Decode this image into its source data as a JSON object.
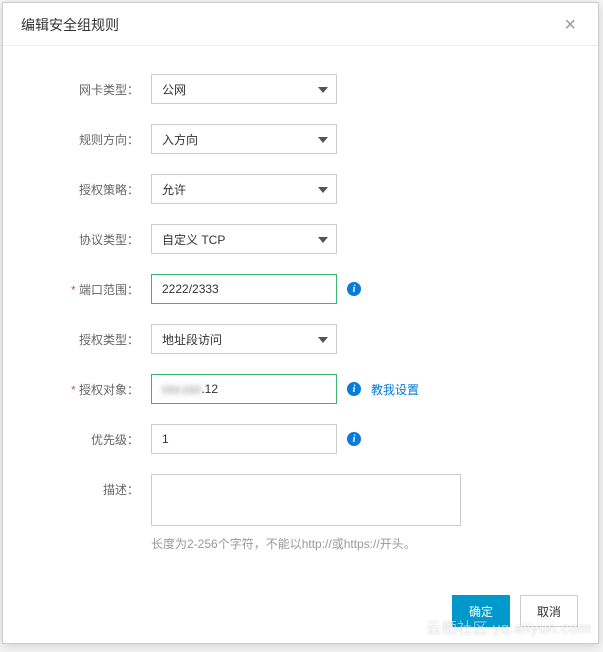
{
  "modal": {
    "title": "编辑安全组规则",
    "close_glyph": "×"
  },
  "form": {
    "nic_type": {
      "label": "网卡类型：",
      "value": "公网"
    },
    "direction": {
      "label": "规则方向：",
      "value": "入方向"
    },
    "policy": {
      "label": "授权策略：",
      "value": "允许"
    },
    "protocol": {
      "label": "协议类型：",
      "value": "自定义 TCP"
    },
    "port_range": {
      "label": "端口范围：",
      "value": "2222/2333"
    },
    "auth_type": {
      "label": "授权类型：",
      "value": "地址段访问"
    },
    "auth_object": {
      "label": "授权对象：",
      "value_masked": "xxx.xxx",
      "value_suffix": ".12",
      "help_link": "教我设置"
    },
    "priority": {
      "label": "优先级：",
      "value": "1"
    },
    "description": {
      "label": "描述：",
      "value": "",
      "hint": "长度为2-256个字符，不能以http://或https://开头。"
    }
  },
  "footer": {
    "ok": "确定",
    "cancel": "取消"
  },
  "watermark": "云栖社区 yq.aliyun.com"
}
